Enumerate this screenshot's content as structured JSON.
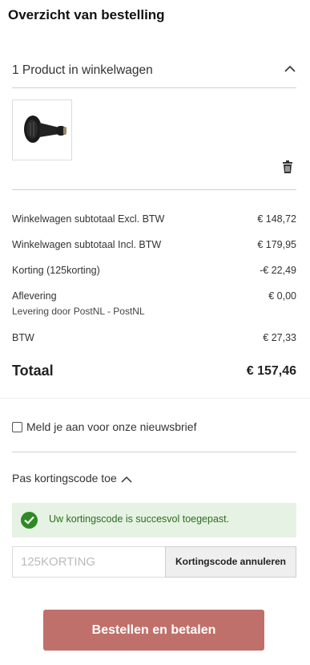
{
  "page_title": "Overzicht van bestelling",
  "cart": {
    "header_label": "1 Product in winkelwagen",
    "product_image": "hair-dryer-diffuser"
  },
  "totals": {
    "rows": [
      {
        "label": "Winkelwagen subtotaal Excl. BTW",
        "value": "€ 148,72"
      },
      {
        "label": "Winkelwagen subtotaal Incl. BTW",
        "value": "€ 179,95"
      },
      {
        "label": "Korting (125korting)",
        "value": "-€ 22,49"
      },
      {
        "label": "Aflevering",
        "value": "€ 0,00",
        "sub": "Levering door PostNL - PostNL"
      },
      {
        "label": "BTW",
        "value": "€ 27,33"
      }
    ],
    "total_label": "Totaal",
    "total_value": "€  157,46"
  },
  "newsletter": {
    "label": "Meld je aan voor onze nieuwsbrief",
    "checked": false
  },
  "coupon": {
    "title": "Pas kortingscode toe",
    "success_message": "Uw kortingscode is succesvol toegepast.",
    "input_value": "125KORTING",
    "cancel_label": "Kortingscode annuleren"
  },
  "checkout": {
    "label": "Bestellen en betalen"
  },
  "colors": {
    "checkout_button": "#c0706a",
    "success_bg": "#e6f2e3",
    "success_text": "#2b6e1e",
    "success_icon": "#2f8a24"
  }
}
